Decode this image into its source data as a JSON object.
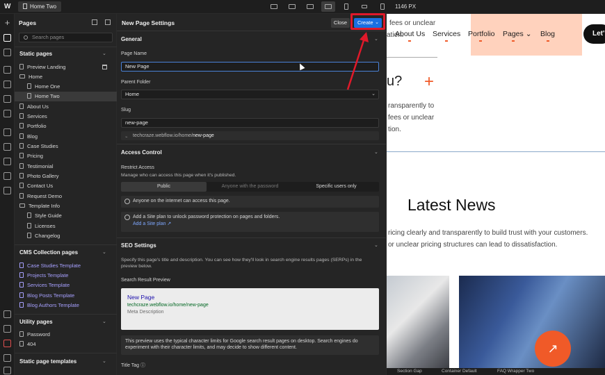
{
  "topbar": {
    "current_page": "Home Two",
    "canvas_width_label": "1146 PX"
  },
  "pages_panel": {
    "title": "Pages",
    "search_placeholder": "Search pages",
    "static_header": "Static pages",
    "static_items": [
      "Preview Landing",
      "Home",
      "Home One",
      "Home Two",
      "About Us",
      "Services",
      "Portfolio",
      "Blog",
      "Case Studies",
      "Pricing",
      "Testimonial",
      "Photo Gallery",
      "Contact Us",
      "Request Demo",
      "Template Info",
      "Style Guide",
      "Licenses",
      "Changelog"
    ],
    "cms_header": "CMS Collection pages",
    "cms_items": [
      "Case Studies Template",
      "Projects Template",
      "Services Template",
      "Blog Posts Template",
      "Blog Authors Template"
    ],
    "utility_header": "Utility pages",
    "utility_items": [
      "Password",
      "404"
    ],
    "templates_header": "Static page templates"
  },
  "settings": {
    "title": "New Page Settings",
    "close_label": "Close",
    "create_label": "Create",
    "general_header": "General",
    "page_name_label": "Page Name",
    "page_name_value": "New Page",
    "parent_folder_label": "Parent Folder",
    "parent_folder_value": "Home",
    "slug_label": "Slug",
    "slug_value": "new-page",
    "url_prefix": "techcraze.webflow.io/home/",
    "url_slug": "new-page",
    "access_header": "Access Control",
    "restrict_label": "Restrict Access",
    "restrict_desc": "Manage who can access this page when it's published.",
    "access_options": [
      "Public",
      "Anyone with the password",
      "Specific users only"
    ],
    "public_info": "Anyone on the internet can access this page.",
    "siteplan_info": "Add a Site plan to unlock password protection on pages and folders.",
    "siteplan_link": "Add a Site plan ↗",
    "seo_header": "SEO Settings",
    "seo_desc": "Specify this page's title and description. You can see how they'll look in search engine results pages (SERPs) in the preview below.",
    "preview_label": "Search Result Preview",
    "serp_title": "New Page",
    "serp_url": "techcraze.webflow.io/home/new-page",
    "serp_desc": "Meta Description",
    "serp_note": "This preview uses the typical character limits for Google search result pages on desktop. Search engines do experiment with their character limits, and may decide to show different content.",
    "title_tag_label": "Title Tag"
  },
  "canvas": {
    "nav": [
      "About Us",
      "Services",
      "Portfolio",
      "Pages",
      "Blog"
    ],
    "cta": "Let'",
    "fees_line1": "fees or unclear",
    "fees_line2": "ation.",
    "question_mark": "u?",
    "para_lines": [
      "ransparently to",
      "fees or unclear",
      "tion."
    ],
    "latest_news": "Latest News",
    "news_lines": [
      "ricing clearly and transparently to build trust with your customers.",
      "or unclear pricing structures can lead to dissatisfaction."
    ],
    "status_items": [
      "Section Gap",
      "Container Default",
      "FAQ Wrapper Two"
    ]
  },
  "colors": {
    "accent_blue": "#1a6fe0",
    "annotation_red": "#e0192a",
    "brand_orange": "#f05a28",
    "peach": "#ffd2bd"
  }
}
